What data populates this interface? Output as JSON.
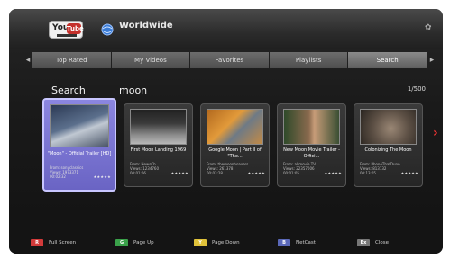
{
  "header": {
    "region": "Worldwide",
    "logo_you": "You",
    "logo_tube": "Tube"
  },
  "tabs": [
    "Top Rated",
    "My Videos",
    "Favorites",
    "Playlists",
    "Search"
  ],
  "search": {
    "label": "Search",
    "query": "moon",
    "page_count": "1/500"
  },
  "videos": [
    {
      "title": "\"Moon\" - Official Trailer [HD]",
      "from": "From: sonyclassics",
      "views": "Views: 1973371",
      "time": "00:02:32",
      "rating": "★★★★★"
    },
    {
      "title": "First Moon Landing 1969",
      "from": "From: NewsCh",
      "views": "Views: 1234760",
      "time": "00:01:06",
      "rating": "★★★★★"
    },
    {
      "title": "Google Moon | Part II of \"The...",
      "from": "From: themoonhoaxers",
      "views": "Views: 261378",
      "time": "00:03:28",
      "rating": "★★★★★"
    },
    {
      "title": "New Moon Movie Trailer - Offici...",
      "from": "From: allmovie TV",
      "views": "Views: 22357006",
      "time": "00:01:05",
      "rating": "★★★★★"
    },
    {
      "title": "Colonizing The Moon",
      "from": "From: PhoneThatDunn",
      "views": "Views: 813132",
      "time": "00:13:05",
      "rating": "★★★★★"
    }
  ],
  "hints": [
    {
      "key": "R",
      "label": "Full Screen",
      "color": "#d23a3a"
    },
    {
      "key": "G",
      "label": "Page Up",
      "color": "#3aa14a"
    },
    {
      "key": "Y",
      "label": "Page Down",
      "color": "#e0c23a"
    },
    {
      "key": "B",
      "label": "NetCast",
      "color": "#5a68b8"
    },
    {
      "key": "Ex",
      "label": "Close",
      "color": "#777777"
    }
  ]
}
